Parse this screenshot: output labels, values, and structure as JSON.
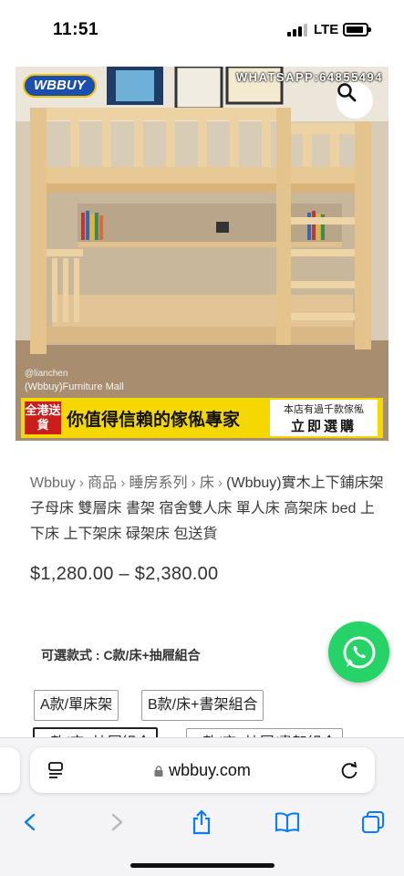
{
  "status_bar": {
    "time": "11:51",
    "network": "LTE"
  },
  "product_image": {
    "brand_logo": "WBBUY",
    "whatsapp_banner": "WHATSAPP:64855494",
    "watermark_user": "@lianchen",
    "watermark_store": "(Wbbuy)Furniture Mall",
    "promo_badge": "全港送貨",
    "promo_main": "你值得信賴的傢俬專家",
    "promo_side_top": "本店有過千款傢俬",
    "promo_side_bottom": "立即選購"
  },
  "breadcrumb": {
    "items": [
      "Wbbuy",
      "商品",
      "睡房系列",
      "床"
    ],
    "separator": "›",
    "title": "(Wbbuy)實木上下鋪床架 子母床 雙層床 書架 宿舍雙人床 單人床 高架床 bed 上下床 上下架床 碌架床 包送貨"
  },
  "price": "$1,280.00 – $2,380.00",
  "options": {
    "label": "可選款式 : C款/床+抽屜組合",
    "buttons": [
      "A款/單床架",
      "B款/床+書架組合",
      "C款/床+抽屜組合",
      "D款/床+抽屜/書架組合"
    ]
  },
  "browser": {
    "url": "wbbuy.com"
  },
  "colors": {
    "whatsapp": "#25d366",
    "promo_yellow": "#f4d800",
    "ios_blue": "#0a7aff"
  },
  "icons": [
    "search-icon",
    "whatsapp-icon",
    "reader-icon",
    "lock-icon",
    "reload-icon",
    "back-icon",
    "forward-icon",
    "share-icon",
    "bookmarks-icon",
    "tabs-icon"
  ]
}
